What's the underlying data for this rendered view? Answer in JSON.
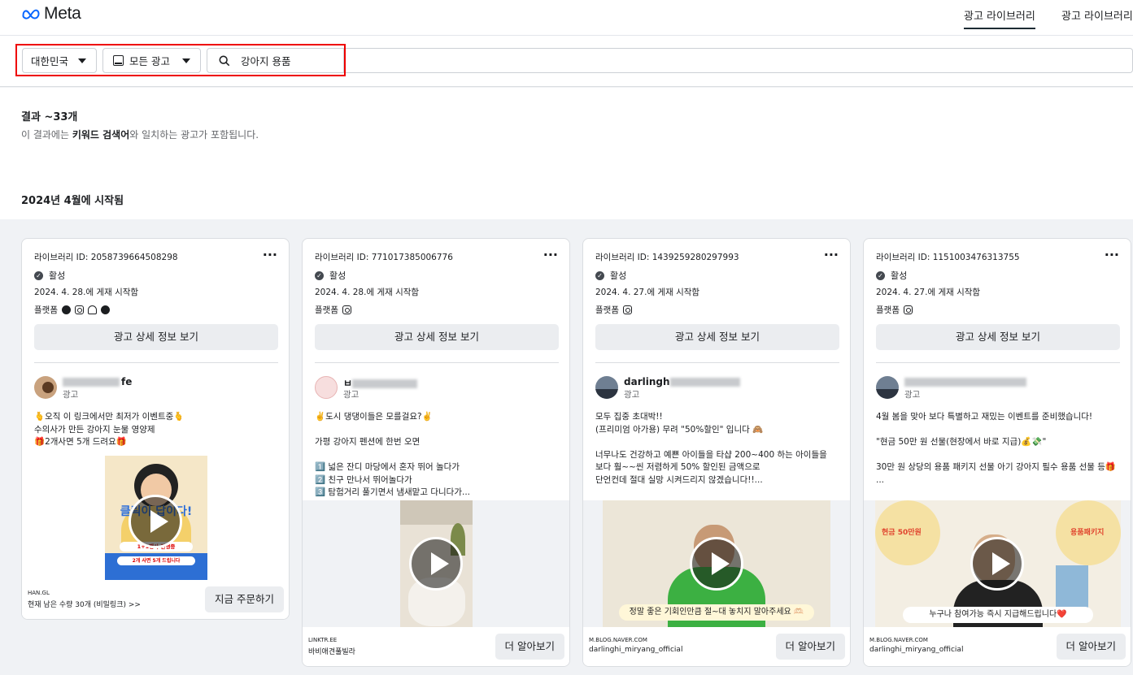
{
  "header": {
    "logo_text": "Meta",
    "tabs": [
      {
        "label": "광고 라이브러리"
      },
      {
        "label": "광고 라이브러리"
      }
    ]
  },
  "filters": {
    "country": "대한민국",
    "ad_type": "모든 광고",
    "search_value": "강아지 용품"
  },
  "results": {
    "count": "결과 ~33개",
    "desc_prefix": "이 결과에는 ",
    "desc_keyword": "키워드 검색어",
    "desc_suffix": "와 일치하는 광고가 포함됩니다.",
    "month_heading": "2024년 4월에 시작됨"
  },
  "cards": [
    {
      "library_id": "라이브러리 ID: 2058739664508298",
      "status": "활성",
      "date": "2024. 4. 28.에 게재 시작함",
      "platform_label": "플랫폼",
      "details_button": "광고 상세 정보 보기",
      "advertiser_visible": "fe",
      "ad_label": "광고",
      "body": "🫰오직 이 링크에서만 최저가 이벤트중🫰\n수의사가 만든 강아지 눈물 영양제\n🎁2개사면 5개 드려요🎁",
      "media_caption_1": "클릭이 답이다!",
      "media_caption_2": "1+1행사 진행중",
      "media_caption_3": "2개 사면 5개 드립니다",
      "domain": "HAN.GL",
      "footer_label": "현재 남은 수량 30개 (비밀링크) >>",
      "cta": "지금 주문하기"
    },
    {
      "library_id": "라이브러리 ID: 771017385006776",
      "status": "활성",
      "date": "2024. 4. 28.에 게재 시작함",
      "platform_label": "플랫폼",
      "details_button": "광고 상세 정보 보기",
      "advertiser_visible": "ㅂ",
      "ad_label": "광고",
      "body": "✌️도시 댕댕이들은 모를걸요?✌️\n\n가평 강아지 펜션에 한번 오면\n\n1️⃣ 넓은 잔디 마당에서 혼자 뛰어 놀다가\n2️⃣ 친구 만나서 뛰어놀다가\n3️⃣ 탐험거리 풀기면서 냄새맡고 다니다가...",
      "domain": "LINKTR.EE",
      "footer_label": "바비애견풀빌라",
      "cta": "더 알아보기"
    },
    {
      "library_id": "라이브러리 ID: 1439259280297993",
      "status": "활성",
      "date": "2024. 4. 27.에 게재 시작함",
      "platform_label": "플랫폼",
      "details_button": "광고 상세 정보 보기",
      "advertiser_visible": "darlingh",
      "ad_label": "광고",
      "body": "모두 집중 초대박!!\n(프리미엄 아가용) 무려 \"50%할인\" 입니다 🙈\n\n너무나도 건강하고 예쁜 아이들을 타샵 200~400 하는 아이들을\n보다 훨~~씬 저렴하게 50% 할인된 금액으로\n단언컨데 절대 실망 시켜드리지 않겠습니다!!...",
      "media_caption": "정말 좋은 기회인만큼 절~대 놓치지 말아주세요 🫶🏻",
      "domain": "M.BLOG.NAVER.COM",
      "footer_label": "darlinghi_miryang_official",
      "cta": "더 알아보기"
    },
    {
      "library_id": "라이브러리 ID: 1151003476313755",
      "status": "활성",
      "date": "2024. 4. 27.에 게재 시작함",
      "platform_label": "플랫폼",
      "details_button": "광고 상세 정보 보기",
      "advertiser_visible": "",
      "ad_label": "광고",
      "body": "4월 봄을 맞아 보다 특별하고 재밌는 이벤트를 준비했습니다!\n\n\"현금 50만 원 선물(현장에서 바로 지급)💰💸\"\n\n30만 원 상당의 용품 패키지 선물 아기 강아지 필수 용품 선물 등🎁\n...",
      "media_caption_left": "현금 50만원",
      "media_caption_right": "용품패키지",
      "media_caption": "누구나 참여가능 즉시 지급해드립니다❤️",
      "domain": "M.BLOG.NAVER.COM",
      "footer_label": "darlinghi_miryang_official",
      "cta": "더 알아보기"
    }
  ],
  "colors": {
    "highlight": "#e00000",
    "meta_blue": "#0866ff"
  }
}
